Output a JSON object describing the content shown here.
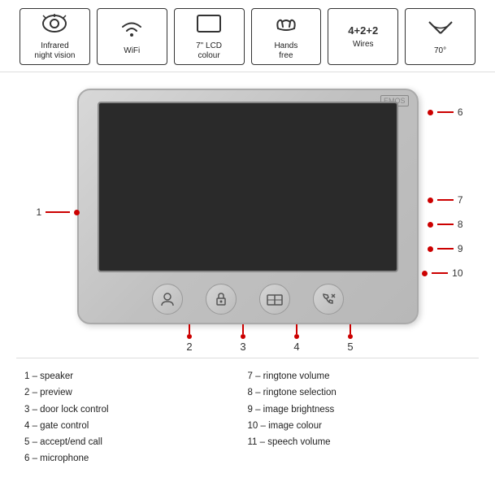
{
  "features": [
    {
      "id": "infrared",
      "icon": "👁",
      "label": "Infrared\nnight vision",
      "unicode": "eye"
    },
    {
      "id": "wifi",
      "icon": "wifi",
      "label": "WiFi"
    },
    {
      "id": "lcd",
      "icon": "lcd",
      "label": "7\" LCD\ncolour"
    },
    {
      "id": "handsfree",
      "icon": "hands",
      "label": "Hands\nfree"
    },
    {
      "id": "wires",
      "icon": "wires",
      "label": "4+2+2\nWires"
    },
    {
      "id": "angle",
      "icon": "angle",
      "label": "70°"
    }
  ],
  "device": {
    "brand": "EMOS"
  },
  "buttons": [
    {
      "id": "btn2",
      "num": "2",
      "icon": "👤"
    },
    {
      "id": "btn3",
      "num": "3",
      "icon": "🔑"
    },
    {
      "id": "btn4",
      "num": "4",
      "icon": "🏠"
    },
    {
      "id": "btn5",
      "num": "5",
      "icon": "📞"
    }
  ],
  "callout_nums": [
    "2",
    "3",
    "4",
    "5"
  ],
  "annotations_left": [
    {
      "num": "1",
      "side": "left"
    }
  ],
  "annotations_right": [
    {
      "num": "6",
      "pos": "top"
    },
    {
      "num": "7"
    },
    {
      "num": "8"
    },
    {
      "num": "9"
    },
    {
      "num": "10"
    }
  ],
  "legend_left": [
    "1 – speaker",
    "2 – preview",
    "3 – door lock control",
    "4 – gate control",
    "5 – accept/end call",
    "6 – microphone"
  ],
  "legend_right": [
    "7 – ringtone volume",
    "8 – ringtone selection",
    "9 – image brightness",
    "10 – image colour",
    "11 – speech volume"
  ]
}
